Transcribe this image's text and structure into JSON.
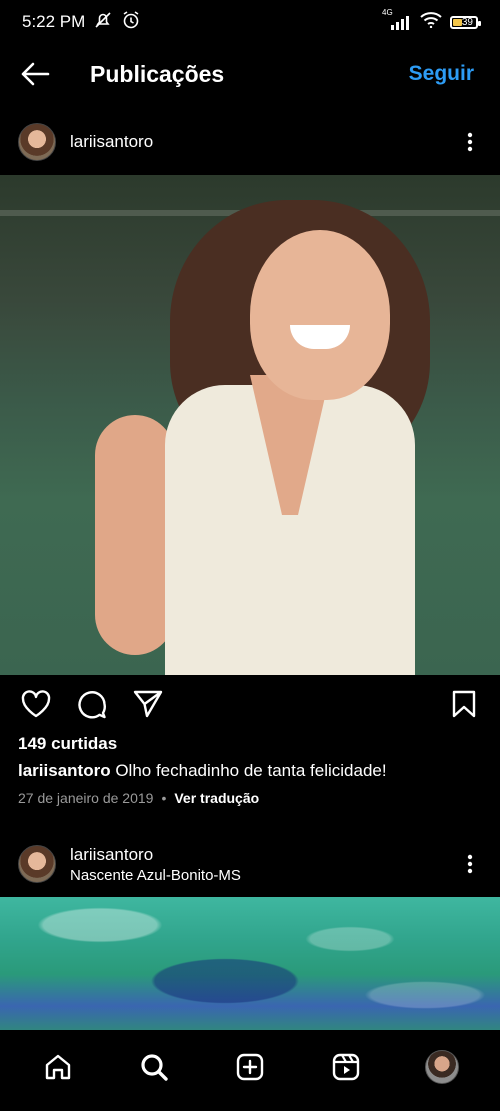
{
  "status_bar": {
    "time": "5:22 PM",
    "network": "4G",
    "battery": "39",
    "icons": [
      "mute-icon",
      "alarm-icon",
      "signal-icon",
      "wifi-icon",
      "battery-icon"
    ]
  },
  "app_bar": {
    "title": "Publicações",
    "follow_label": "Seguir"
  },
  "post1": {
    "username": "lariisantoro",
    "likes": "149 curtidas",
    "caption_user": "lariisantoro",
    "caption_text": " Olho fechadinho de tanta felicidade!",
    "date": "27 de janeiro de 2019",
    "separator": "•",
    "translate": "Ver tradução"
  },
  "post2": {
    "username": "lariisantoro",
    "location": "Nascente Azul-Bonito-MS"
  },
  "bottom_nav": {
    "items": [
      "home-icon",
      "search-icon",
      "add-post-icon",
      "reels-icon",
      "profile-avatar"
    ]
  },
  "colors": {
    "background": "#000000",
    "accent": "#2d9cf5",
    "muted": "#9a9a9a"
  }
}
